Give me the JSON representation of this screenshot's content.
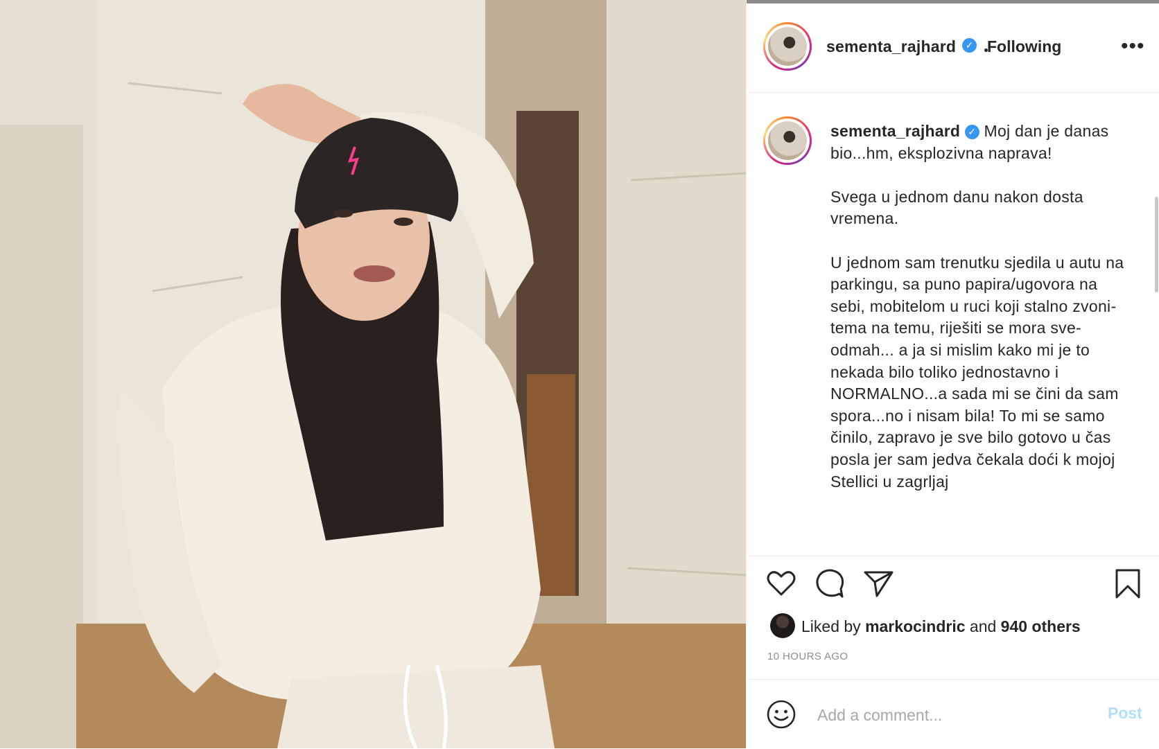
{
  "post": {
    "image_alt": "Woman in cream sweatsuit and black beanie posing in a hallway",
    "author": {
      "username": "sementa_rajhard",
      "verified": true,
      "follow_status": "Following"
    },
    "caption": {
      "username": "sementa_rajhard",
      "intro": " Moj dan je danas bio...hm, eksplozivna naprava!",
      "paragraph_2": "Svega u jednom danu nakon dosta vremena.",
      "paragraph_3": "U jednom sam trenutku sjedila u autu na parkingu, sa puno papira/ugovora na sebi, mobitelom u ruci koji stalno zvoni- tema na temu, riješiti se mora sve-odmah... a ja si mislim kako mi je to nekada bilo toliko jednostavno i NORMALNO...a sada mi se čini da sam spora...no i nisam bila! To mi se samo činilo, zapravo je sve bilo gotovo u čas posla jer sam jedva čekala doći k mojoj Stellici u zagrljaj"
    },
    "likes": {
      "prefix": "Liked by ",
      "user": "markocindric",
      "suffix": " and ",
      "others": "940 others"
    },
    "timestamp": "10 HOURS AGO",
    "comment": {
      "placeholder": "Add a comment...",
      "post_label": "Post"
    },
    "more_label": "•••",
    "verified_glyph": "✓",
    "icons": [
      "heart-icon",
      "comment-icon",
      "share-icon",
      "bookmark-icon",
      "emoji-icon",
      "more-icon",
      "verified-icon"
    ]
  },
  "colors": {
    "accent": "#3897f0",
    "post_disabled": "#b2dffc",
    "muted": "#8e8e8e"
  }
}
